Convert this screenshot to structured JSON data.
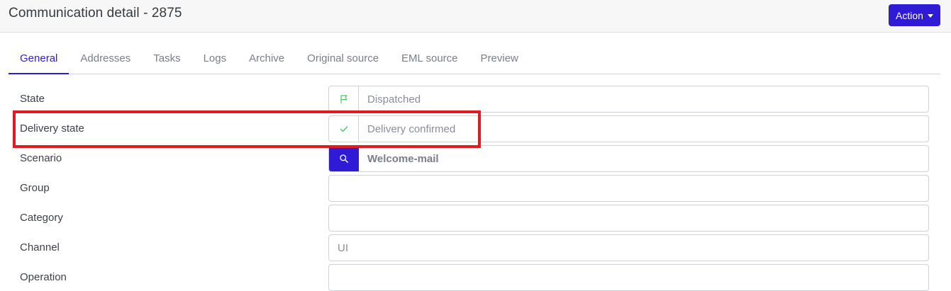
{
  "header": {
    "title": "Communication detail - 2875",
    "action_label": "Action"
  },
  "tabs": [
    {
      "label": "General",
      "active": true
    },
    {
      "label": "Addresses"
    },
    {
      "label": "Tasks"
    },
    {
      "label": "Logs"
    },
    {
      "label": "Archive"
    },
    {
      "label": "Original source"
    },
    {
      "label": "EML source"
    },
    {
      "label": "Preview"
    }
  ],
  "fields": {
    "state": {
      "label": "State",
      "value": "Dispatched",
      "icon": "flag-icon"
    },
    "delivery_state": {
      "label": "Delivery state",
      "value": "Delivery confirmed",
      "icon": "check-icon"
    },
    "scenario": {
      "label": "Scenario",
      "value": "Welcome-mail",
      "icon": "search-icon"
    },
    "group": {
      "label": "Group",
      "value": ""
    },
    "category": {
      "label": "Category",
      "value": ""
    },
    "channel": {
      "label": "Channel",
      "value": "UI"
    },
    "operation": {
      "label": "Operation",
      "value": ""
    }
  },
  "colors": {
    "primary": "#2f1bd6",
    "icon_green": "#4cc46c",
    "highlight_red": "#e11b22"
  }
}
